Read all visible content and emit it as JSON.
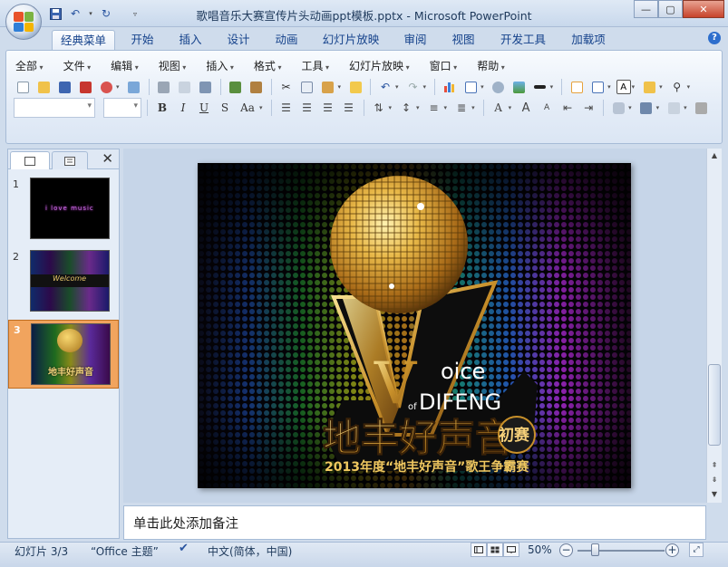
{
  "window": {
    "title": "歌唱音乐大赛宣传片头动画ppt模板.pptx - Microsoft PowerPoint",
    "minimize": "—",
    "maximize": "▢",
    "close": "✕"
  },
  "tabs": [
    "经典菜单",
    "开始",
    "插入",
    "设计",
    "动画",
    "幻灯片放映",
    "审阅",
    "视图",
    "开发工具",
    "加载项"
  ],
  "active_tab": "经典菜单",
  "classic_menu": [
    "全部",
    "文件",
    "编辑",
    "视图",
    "插入",
    "格式",
    "工具",
    "幻灯片放映",
    "窗口",
    "帮助"
  ],
  "format_buttons": [
    "B",
    "I",
    "U",
    "S",
    "Aa"
  ],
  "slides_pane": {
    "close": "✕",
    "slides": [
      {
        "number": "1",
        "text": "i love music"
      },
      {
        "number": "2",
        "text": "Welcome"
      },
      {
        "number": "3",
        "text": "地丰好声音"
      }
    ],
    "selected": "3"
  },
  "slide": {
    "voice_v": "V",
    "oice": "oice",
    "of": "of",
    "difeng": "DIFENG",
    "main_title": "地丰好声音",
    "badge": "初赛",
    "subtitle": "2013年度“地丰好声音”歌王争霸赛"
  },
  "notes": {
    "placeholder": "单击此处添加备注"
  },
  "status": {
    "slide_info": "幻灯片 3/3",
    "theme": "“Office 主题”",
    "language": "中文(简体，中国)",
    "zoom": "50%",
    "zoom_out": "−",
    "zoom_in": "+"
  },
  "colors": {
    "accent": "#15428b",
    "selected_thumb": "#f1a45e"
  }
}
